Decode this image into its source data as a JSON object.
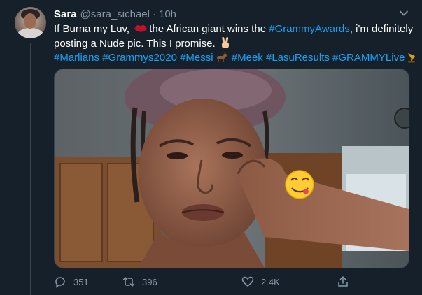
{
  "tweet": {
    "author_name": "Sara",
    "author_handle": "@sara_sichael",
    "separator": "·",
    "time": "10h",
    "text": {
      "line1_a": "If Burna my Luv, ",
      "line1_b": "the African giant wins the ",
      "line1_hashtag": "#GrammyAwards",
      "line1_c": ", i'm definitely",
      "line2": "posting a Nude pic. This I promise. ",
      "hashtags_line": [
        "#Marlians",
        "#Grammys2020",
        "#Messi",
        "#Meek",
        "#LasuResults",
        "#GRAMMYLive"
      ]
    },
    "icons": {
      "avatar": "avatar",
      "chevron": "chevron-down-icon",
      "lips": "kiss-mark-emoji",
      "victory": "victory-hand-emoji",
      "ram": "goat-emoji",
      "gramophone": "gramophone-emoji",
      "face": "face-savoring-food-emoji"
    }
  },
  "actions": {
    "replies": "351",
    "retweets": "396",
    "likes": "2.4K"
  },
  "colors": {
    "background": "#15202b",
    "link": "#1da1f2",
    "secondary_text": "#8899a6",
    "divider": "#38444d"
  }
}
